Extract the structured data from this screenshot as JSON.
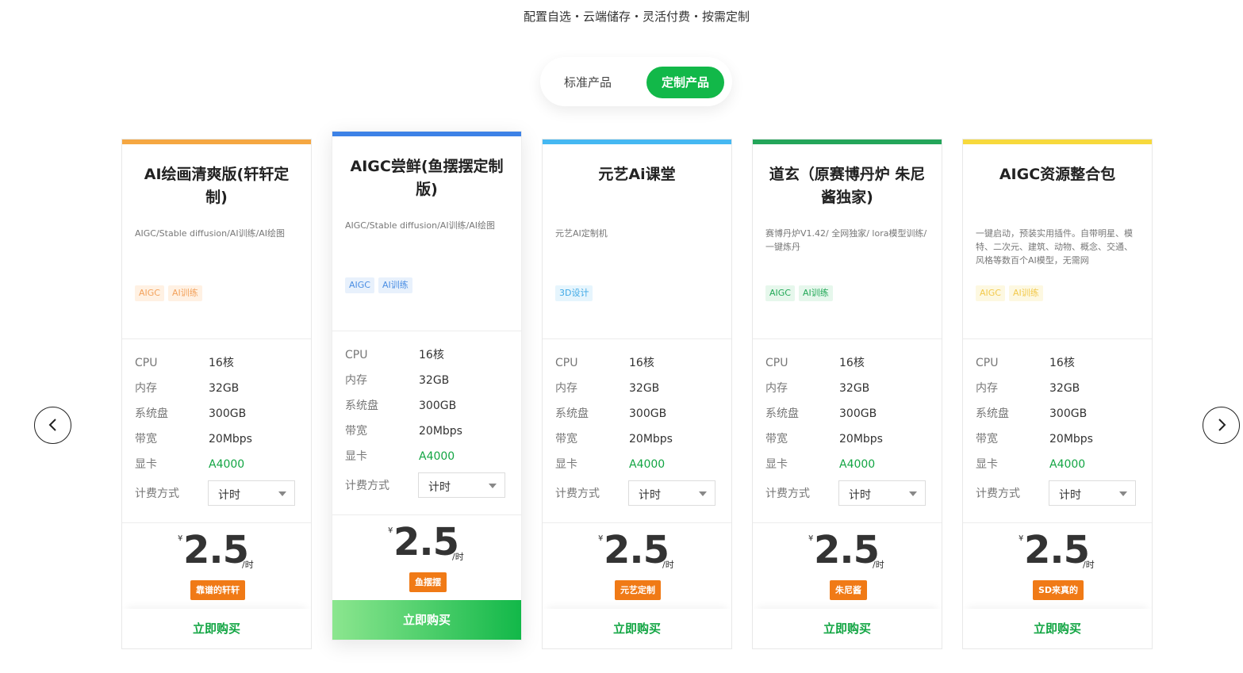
{
  "header": {
    "subtitle": "配置自选・云端储存・灵活付费・按需定制"
  },
  "switcher": {
    "standard_label": "标准产品",
    "custom_label": "定制产品",
    "active": "custom"
  },
  "spec_labels": {
    "cpu": "CPU",
    "memory": "内存",
    "disk": "系统盘",
    "bandwidth": "带宽",
    "gpu": "显卡",
    "billing": "计费方式"
  },
  "currency_symbol": "¥",
  "accent_color": "#12b849",
  "cards": [
    {
      "title": "AI绘画清爽版(轩轩定制)",
      "top_color": "#f5a742",
      "description": "AIGC/Stable diffusion/AI训练/AI绘图",
      "tags": [
        "AIGC",
        "AI训练"
      ],
      "tag_color": "#f3a25c",
      "tag_bg": "#fff1e3",
      "cpu": "16核",
      "memory": "32GB",
      "disk": "300GB",
      "bandwidth": "20Mbps",
      "gpu": "A4000",
      "billing": "计时",
      "price": "2.5",
      "unit": "/时",
      "badge": "靠谱的轩轩",
      "buy_label": "立即购买"
    },
    {
      "title": "AIGC尝鲜(鱼摆摆定制版)",
      "top_color": "#3d82e6",
      "description": "AIGC/Stable diffusion/AI训练/AI绘图",
      "tags": [
        "AIGC",
        "AI训练"
      ],
      "tag_color": "#4a8ee3",
      "tag_bg": "#e8f1fc",
      "cpu": "16核",
      "memory": "32GB",
      "disk": "300GB",
      "bandwidth": "20Mbps",
      "gpu": "A4000",
      "billing": "计时",
      "price": "2.5",
      "unit": "/时",
      "badge": "鱼摆摆",
      "buy_label": "立即购买"
    },
    {
      "title": "元艺Ai课堂",
      "top_color": "#45b8f2",
      "description": "元艺AI定制机",
      "tags": [
        "3D设计"
      ],
      "tag_color": "#3fa9e6",
      "tag_bg": "#e6f5fd",
      "cpu": "16核",
      "memory": "32GB",
      "disk": "300GB",
      "bandwidth": "20Mbps",
      "gpu": "A4000",
      "billing": "计时",
      "price": "2.5",
      "unit": "/时",
      "badge": "元艺定制",
      "buy_label": "立即购买"
    },
    {
      "title": "道玄（原赛博丹炉 朱尼酱独家)",
      "top_color": "#24a65a",
      "description": "赛博丹炉V1.42/ 全网独家/ lora模型训练/ 一键炼丹",
      "tags": [
        "AIGC",
        "AI训练"
      ],
      "tag_color": "#22a857",
      "tag_bg": "#e6f7ec",
      "cpu": "16核",
      "memory": "32GB",
      "disk": "300GB",
      "bandwidth": "20Mbps",
      "gpu": "A4000",
      "billing": "计时",
      "price": "2.5",
      "unit": "/时",
      "badge": "朱尼酱",
      "buy_label": "立即购买"
    },
    {
      "title": "AIGC资源整合包",
      "top_color": "#f7d93c",
      "description": "一键启动，预装实用插件。自带明星、模特、二次元、建筑、动物、概念、交通、风格等数百个AI模型，无需网",
      "tags": [
        "AIGC",
        "AI训练"
      ],
      "tag_color": "#f2c94c",
      "tag_bg": "#fdf8e1",
      "cpu": "16核",
      "memory": "32GB",
      "disk": "300GB",
      "bandwidth": "20Mbps",
      "gpu": "A4000",
      "billing": "计时",
      "price": "2.5",
      "unit": "/时",
      "badge": "SD来真的",
      "buy_label": "立即购买"
    }
  ]
}
